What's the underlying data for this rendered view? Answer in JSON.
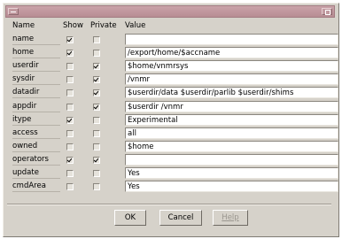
{
  "window": {
    "menu_icon": "window-menu-icon",
    "maximize_icon": "maximize-icon"
  },
  "columns": {
    "name": "Name",
    "show": "Show",
    "private": "Private",
    "value": "Value"
  },
  "rows": [
    {
      "name": "name",
      "show": true,
      "private": false,
      "value": ""
    },
    {
      "name": "home",
      "show": true,
      "private": false,
      "value": "/export/home/$accname"
    },
    {
      "name": "userdir",
      "show": false,
      "private": true,
      "value": "$home/vnmrsys"
    },
    {
      "name": "sysdir",
      "show": false,
      "private": true,
      "value": "/vnmr"
    },
    {
      "name": "datadir",
      "show": false,
      "private": true,
      "value": "$userdir/data $userdir/parlib $userdir/shims"
    },
    {
      "name": "appdir",
      "show": false,
      "private": true,
      "value": "$userdir /vnmr"
    },
    {
      "name": "itype",
      "show": true,
      "private": false,
      "value": "Experimental"
    },
    {
      "name": "access",
      "show": false,
      "private": false,
      "value": "all"
    },
    {
      "name": "owned",
      "show": false,
      "private": false,
      "value": "$home"
    },
    {
      "name": "operators",
      "show": true,
      "private": true,
      "value": ""
    },
    {
      "name": "update",
      "show": false,
      "private": false,
      "value": "Yes"
    },
    {
      "name": "cmdArea",
      "show": false,
      "private": false,
      "value": "Yes"
    }
  ],
  "buttons": {
    "ok": "OK",
    "cancel": "Cancel",
    "help": "Help"
  }
}
